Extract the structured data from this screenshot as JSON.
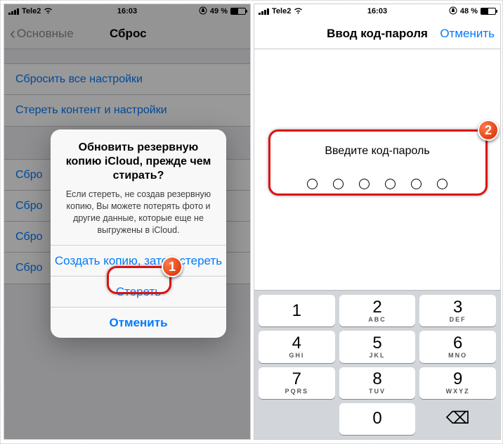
{
  "left": {
    "status": {
      "carrier": "Tele2",
      "time": "16:03",
      "battery": "49 %"
    },
    "nav": {
      "back": "Основные",
      "title": "Сброс"
    },
    "list_top": [
      "Сбросить все настройки",
      "Стереть контент и настройки"
    ],
    "list_bottom": [
      "Сбро",
      "Сбро",
      "Сбро",
      "Сбро"
    ],
    "sheet": {
      "title": "Обновить резервную копию iCloud, прежде чем стирать?",
      "message": "Если стереть, не создав резервную копию, Вы можете потерять фото и другие данные, которые еще не выгружены в iCloud.",
      "backup_then_erase": "Создать копию, затем стереть",
      "erase": "Стереть",
      "cancel": "Отменить"
    },
    "badge": "1"
  },
  "right": {
    "status": {
      "carrier": "Tele2",
      "time": "16:03",
      "battery": "48 %"
    },
    "nav": {
      "title": "Ввод код-пароля",
      "cancel": "Отменить"
    },
    "prompt": "Введите код-пароль",
    "keys": [
      {
        "d": "1",
        "l": ""
      },
      {
        "d": "2",
        "l": "ABC"
      },
      {
        "d": "3",
        "l": "DEF"
      },
      {
        "d": "4",
        "l": "GHI"
      },
      {
        "d": "5",
        "l": "JKL"
      },
      {
        "d": "6",
        "l": "MNO"
      },
      {
        "d": "7",
        "l": "PQRS"
      },
      {
        "d": "8",
        "l": "TUV"
      },
      {
        "d": "9",
        "l": "WXYZ"
      },
      {
        "d": "",
        "l": ""
      },
      {
        "d": "0",
        "l": ""
      },
      {
        "d": "⌫",
        "l": ""
      }
    ],
    "badge": "2"
  }
}
